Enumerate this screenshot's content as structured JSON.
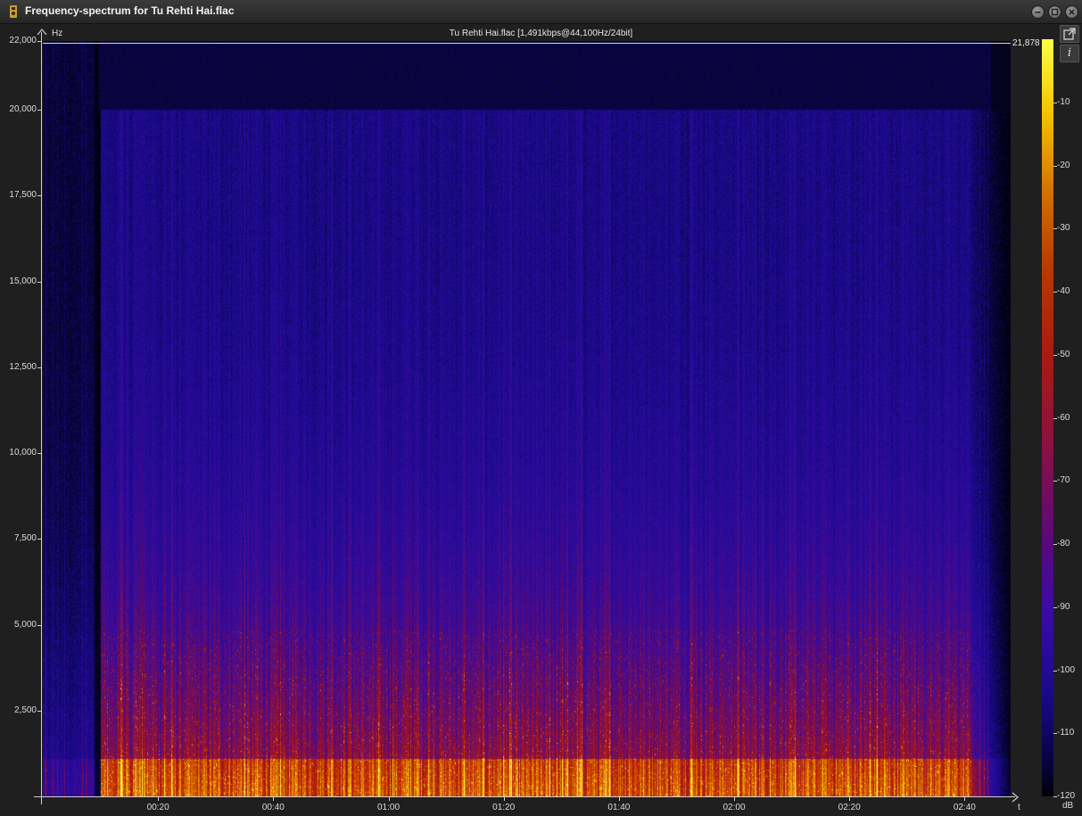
{
  "window": {
    "title": "Frequency-spectrum for Tu Rehti Hai.flac"
  },
  "header": {
    "file_info": "Tu Rehti Hai.flac [1,491kbps@44,100Hz/24bit]",
    "y_unit": "Hz",
    "x_unit": "t",
    "max_freq_label": "21,878",
    "legend_unit": "dB"
  },
  "buttons": {
    "export_icon": "external-link-icon",
    "info_label": "i"
  },
  "chart_data": {
    "type": "heatmap",
    "y_axis": {
      "unit": "Hz",
      "ticks": [
        "2,500",
        "5,000",
        "7,500",
        "10,000",
        "12,500",
        "15,000",
        "17,500",
        "20,000",
        "22,000"
      ],
      "range": [
        0,
        22000
      ]
    },
    "x_axis": {
      "unit": "t",
      "ticks": [
        "00:20",
        "00:40",
        "01:00",
        "01:20",
        "01:40",
        "02:00",
        "02:20",
        "02:40"
      ],
      "range_seconds": [
        0,
        168
      ]
    },
    "colorbar": {
      "unit": "dB",
      "ticks": [
        "-10",
        "-20",
        "-30",
        "-40",
        "-50",
        "-60",
        "-70",
        "-80",
        "-90",
        "-100",
        "-110",
        "-120"
      ],
      "range": [
        -120,
        0
      ]
    },
    "cutoff_hz": 21878,
    "colors": {
      "high": "#ffff44",
      "mid": "#b83a00",
      "low": "#1a0a8c",
      "floor": "#000008"
    }
  }
}
